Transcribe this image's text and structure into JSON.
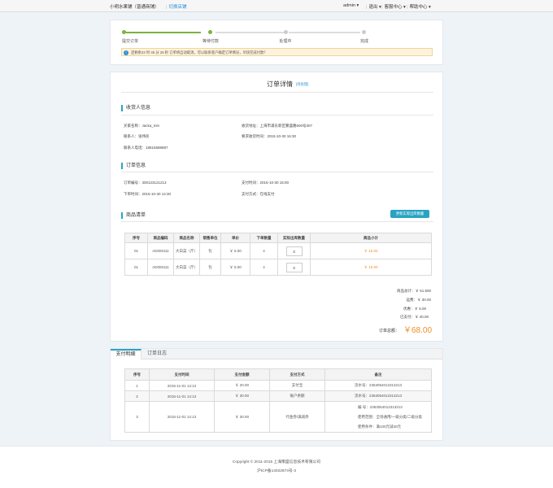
{
  "topbar": {
    "shop_name": "小明水果铺（普通商铺）",
    "switch_label": "切换店铺",
    "user": "admin",
    "logout": "退出",
    "service": "客服中心",
    "help": "帮助中心"
  },
  "steps": {
    "items": [
      {
        "label": "提交订单",
        "done": true
      },
      {
        "label": "等待付款",
        "done": true
      },
      {
        "label": "处理中",
        "done": false
      },
      {
        "label": "完成",
        "done": false
      }
    ],
    "notice_icon": "info-icon",
    "notice": "还剩余23 时 45 分 25 秒 订单将自动取消，可以联系客户确定订单情况，尽快完成付款？"
  },
  "detail": {
    "title": "订单详情",
    "status_link": "[待处理]",
    "receiver": {
      "heading": "收货人信息",
      "buyer_label": "买家名称：",
      "buyer": "Jacka_min",
      "contact_label": "联系人：",
      "contact": "张伟民",
      "phone_label": "联系人电话：",
      "phone": "18816588887",
      "address_label": "收货地址：",
      "address": "上海市浦东新区繁盛路500号307",
      "time_label": "要求收货时间：",
      "time": "2015-10-30   16:30"
    },
    "order": {
      "heading": "订单信息",
      "no_label": "订单编号：",
      "no": "300123121213",
      "placed_label": "下单时间：",
      "placed": "2015-10-30   14:30",
      "paytime_label": "支付时间：",
      "paytime": "2015-10-30   15:00",
      "paymethod_label": "支付方式：",
      "paymethod": "在线支付"
    },
    "goods": {
      "heading": "商品清单",
      "update_button": "更新实际出库数量",
      "columns": [
        "序号",
        "商品编码",
        "商品名称",
        "销售单位",
        "单价",
        "下单数量",
        "实际出库数量",
        "商品小计"
      ],
      "rows": [
        {
          "no": "01",
          "code": "AD000111",
          "name": "大白菜（斤）",
          "unit": "包",
          "price": "￥ 5.00",
          "qty": "4",
          "actual": "3",
          "subtotal": "￥ 15.00"
        },
        {
          "no": "01",
          "code": "AD000111",
          "name": "大白菜（斤）",
          "unit": "包",
          "price": "￥ 5.00",
          "qty": "4",
          "actual": "3",
          "subtotal": "￥ 15.00"
        }
      ]
    },
    "totals": {
      "goods_label": "商品总计：",
      "goods": "￥ 61.500",
      "shipping_label": "运费：",
      "shipping": "￥ 30.00",
      "discount_label": "优惠：",
      "discount": "￥ 5.00",
      "paid_label": "已支付：",
      "paid": "￥ 40.00",
      "grand_label": "订单总额：",
      "grand": "￥68.00"
    }
  },
  "payment": {
    "tabs": [
      "支付明细",
      "订单日志"
    ],
    "columns": [
      "序号",
      "支付时间",
      "支付金额",
      "支付方式",
      "备注"
    ],
    "rows": [
      {
        "no": "1",
        "time": "2015-11-01 14:13",
        "amount": "￥ 20.00",
        "method": "支付宝",
        "remarks": [
          "流水号：2353054012313213"
        ]
      },
      {
        "no": "2",
        "time": "2015-11-01 14:13",
        "amount": "￥ 30.00",
        "method": "账户余额",
        "remarks": [
          "流水号：2353054012313213"
        ]
      },
      {
        "no": "3",
        "time": "2015-11-01 14:13",
        "amount": "￥ 30.00",
        "method": "代金券/满减券",
        "remarks": [
          "编    号：2353054012313213",
          "使用范围：全场通用/一级分类/二级分类",
          "使用条件：满100元减30元"
        ]
      }
    ]
  },
  "footer": {
    "copyright": "Copyright © 2011-2015 上海策盛信息技术有限公司",
    "icp": "沪ICP备14022874号-3"
  },
  "colors": {
    "accent": "#2aa3c3",
    "link": "#2a8fd6",
    "progress": "#7ab33e",
    "price": "#f08c28"
  }
}
